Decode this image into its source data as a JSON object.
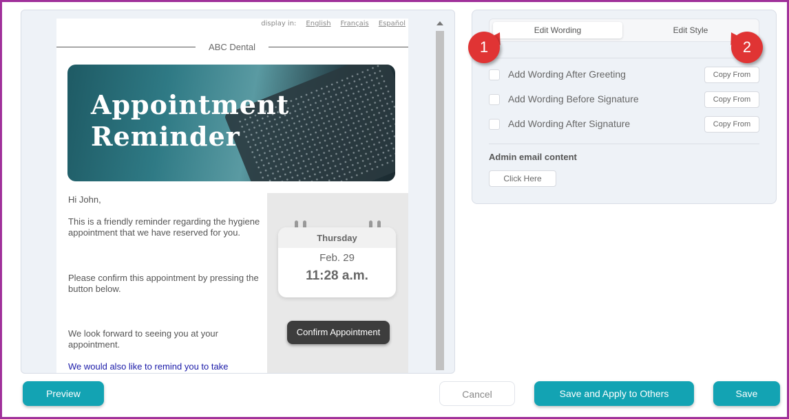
{
  "preview": {
    "languages_label": "display in:",
    "languages": [
      "English",
      "Français",
      "Español"
    ],
    "brand_name": "ABC Dental",
    "banner_title_line1": "Appointment",
    "banner_title_line2": "Reminder",
    "greeting": "Hi John,",
    "paragraph1": "This is a friendly reminder regarding the hygiene appointment that we have reserved for you.",
    "paragraph2": "Please confirm this appointment by pressing the button below.",
    "paragraph3": "We look forward to seeing you at your appointment.",
    "paragraph4": "We would also like to remind you to take",
    "calendar_day": "Thursday",
    "calendar_date": "Feb. 29",
    "calendar_time": "11:28 a.m.",
    "confirm_button": "Confirm Appointment"
  },
  "settings": {
    "tabs": [
      {
        "label": "Edit Wording",
        "active": true
      },
      {
        "label": "Edit Style",
        "active": false
      }
    ],
    "options": [
      {
        "label": "Add Wording After Greeting",
        "checked": false,
        "copy_label": "Copy From"
      },
      {
        "label": "Add Wording Before Signature",
        "checked": false,
        "copy_label": "Copy From"
      },
      {
        "label": "Add Wording After Signature",
        "checked": false,
        "copy_label": "Copy From"
      }
    ],
    "admin_label": "Admin email content",
    "admin_button": "Click Here"
  },
  "callouts": [
    "1",
    "2"
  ],
  "footer": {
    "preview": "Preview",
    "cancel": "Cancel",
    "save_apply": "Save and Apply to Others",
    "save": "Save"
  },
  "colors": {
    "accent": "#13a3b3",
    "callout": "#e03434",
    "frame": "#a0309a"
  }
}
